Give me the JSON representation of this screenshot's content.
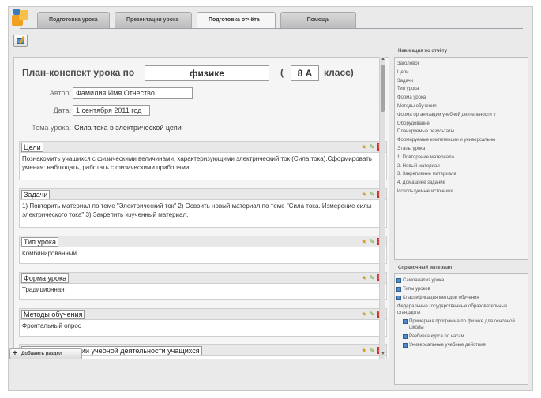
{
  "tabs": [
    {
      "label": "Подготовка урока"
    },
    {
      "label": "Презентация урока"
    },
    {
      "label": "Подготовка отчёта"
    },
    {
      "label": "Помощь"
    }
  ],
  "header": {
    "title": "План-конспект урока по",
    "subject": "физике",
    "paren": "(",
    "class_value": "8 А",
    "class_suffix": "класс)"
  },
  "meta": {
    "author_label": "Автор:",
    "author_value": "Фамилия Имя Отчество",
    "date_label": "Дата:",
    "date_value": "1 сентября 2011 год",
    "topic_label": "Тема урока:",
    "topic_value": "Сила тока в электрической цепи"
  },
  "sections": [
    {
      "title": "Цели",
      "body": "Познакомить учащихся с физическими величинами, характеризующими электрический ток (Сила тока).Сформировать умения: наблюдать, работать с физическими приборами"
    },
    {
      "title": "Задачи",
      "body": "1) Повторить материал по теме \"Электрический ток\" 2) Освоить новый материал по теме \"Сила тока. Измерение силы электрического тока\".3) Закрепить изученный материал."
    },
    {
      "title": "Тип урока",
      "body": "Комбинированный"
    },
    {
      "title": "Форма урока",
      "body": "Традиционная"
    },
    {
      "title": "Методы обучения",
      "body": "Фронтальный опрос"
    },
    {
      "title": "Форма организации учебной деятельности учащихся",
      "body": ""
    }
  ],
  "add_section_label": "Добавить раздел",
  "nav": {
    "heading": "Навигация по отчёту",
    "items": [
      "Заголовок",
      "Цели",
      "Задачи",
      "Тип урока",
      "Форма урока",
      "Методы обучения",
      "Форма организации учебной деятельности у",
      "Оборудование",
      "Планируемые результаты",
      "Формируемые компетенции и универсальны",
      "Этапы урока",
      "1. Повторение материала",
      "2. Новый материал",
      "3. Закрепление материала",
      "4. Домашнее задание",
      "Используемые источники"
    ]
  },
  "reference": {
    "heading": "Справочный материал",
    "items": [
      {
        "label": "Самоанализ урока",
        "kind": "link"
      },
      {
        "label": "Типы уроков",
        "kind": "link"
      },
      {
        "label": "Классификация методов обучения",
        "kind": "link"
      },
      {
        "label": "Федеральные государственные образовательные стандарты",
        "kind": "plain"
      },
      {
        "label": "Примерная программа по физике для основной школы",
        "kind": "indent"
      },
      {
        "label": "Разбивка курса по часам",
        "kind": "indent"
      },
      {
        "label": "Универсальные учебные действия",
        "kind": "indent"
      }
    ]
  },
  "icons": {
    "toolbar": "edit-document-icon",
    "section_actions": [
      "star-icon",
      "edit-icon",
      "delete-icon"
    ]
  },
  "colors": {
    "delete": "#d42a2a",
    "link_icon": "#4d8fcf",
    "accent_logo": "#f0a020"
  }
}
